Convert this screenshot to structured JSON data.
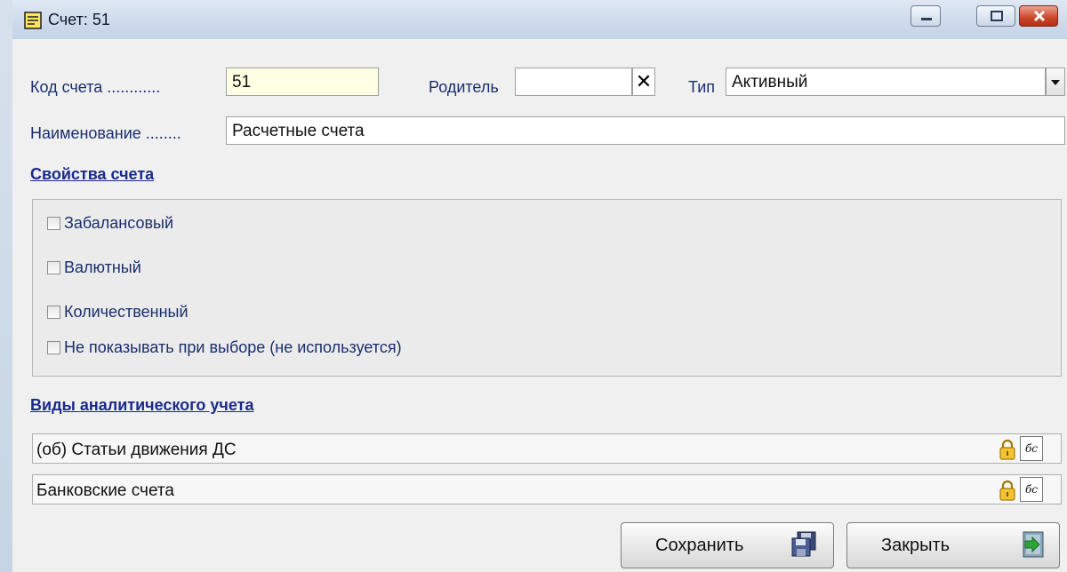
{
  "window": {
    "title": "Счет: 51"
  },
  "fields": {
    "code_label": "Код счета",
    "code_dots": "............",
    "code_value": "51",
    "parent_label": "Родитель",
    "parent_value": "",
    "clear_glyph": "✕",
    "type_label": "Тип",
    "type_value": "Активный",
    "name_label": "Наименование",
    "name_dots": "........",
    "name_value": "Расчетные счета"
  },
  "properties": {
    "title": "Свойства счета",
    "items": [
      {
        "label": "Забалансовый",
        "checked": false
      },
      {
        "label": "Валютный",
        "checked": false
      },
      {
        "label": "Количественный",
        "checked": false
      },
      {
        "label": "Не показывать при выборе (не используется)",
        "checked": false
      }
    ]
  },
  "analytics": {
    "title": "Виды аналитического учета",
    "rows": [
      {
        "label": "(об) Статьи движения ДС",
        "btn": "бс"
      },
      {
        "label": "Банковские счета",
        "btn": "бс"
      }
    ]
  },
  "buttons": {
    "save_label": "Сохранить",
    "close_label": "Закрыть"
  },
  "colors": {
    "label": "#1a2e6e",
    "link": "#1a2a8a",
    "code_field_bg": "#ffffe4",
    "close_btn": "#c9452b"
  },
  "icons": [
    "window-document-icon",
    "clear-icon",
    "dropdown-arrow-icon",
    "lock-icon",
    "glasses-icon",
    "save-floppy-icon",
    "exit-door-icon"
  ]
}
